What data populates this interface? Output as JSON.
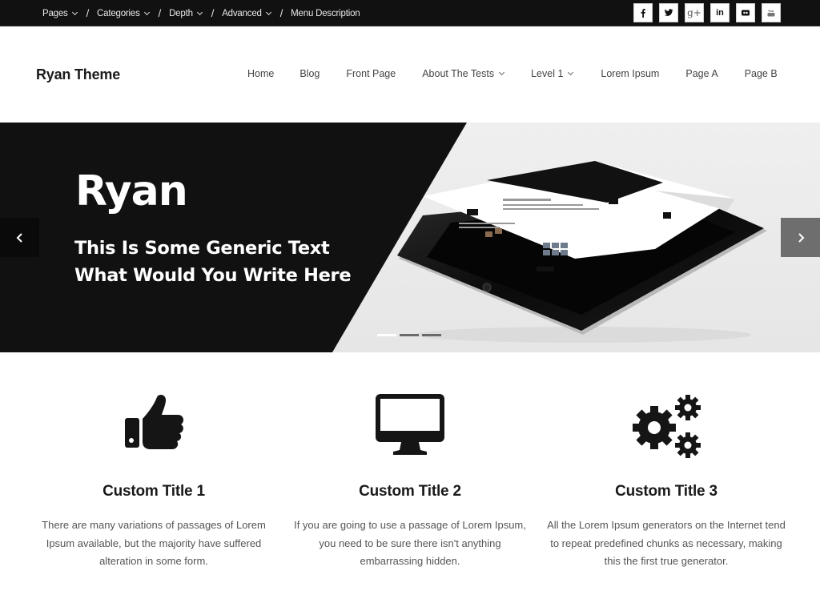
{
  "topbar": {
    "menu": [
      {
        "label": "Pages",
        "has_dropdown": true
      },
      {
        "label": "Categories",
        "has_dropdown": true
      },
      {
        "label": "Depth",
        "has_dropdown": true
      },
      {
        "label": "Advanced",
        "has_dropdown": true
      },
      {
        "label": "Menu Description",
        "has_dropdown": false
      }
    ],
    "separator": "/",
    "social": [
      {
        "name": "facebook",
        "icon": "facebook-icon"
      },
      {
        "name": "twitter",
        "icon": "twitter-icon"
      },
      {
        "name": "google-plus",
        "icon": "google-plus-icon"
      },
      {
        "name": "linkedin",
        "icon": "linkedin-icon"
      },
      {
        "name": "flickr",
        "icon": "flickr-icon"
      },
      {
        "name": "youtube",
        "icon": "youtube-icon"
      }
    ]
  },
  "header": {
    "brand": "Ryan Theme",
    "nav": [
      {
        "label": "Home",
        "has_dropdown": false
      },
      {
        "label": "Blog",
        "has_dropdown": false
      },
      {
        "label": "Front Page",
        "has_dropdown": false
      },
      {
        "label": "About The Tests",
        "has_dropdown": true
      },
      {
        "label": "Level 1",
        "has_dropdown": true
      },
      {
        "label": "Lorem Ipsum",
        "has_dropdown": false
      },
      {
        "label": "Page A",
        "has_dropdown": false
      },
      {
        "label": "Page B",
        "has_dropdown": false
      }
    ]
  },
  "slider": {
    "title": "Ryan",
    "subtitle_line1": "This Is Some Generic Text",
    "subtitle_line2": "What Would You Write Here",
    "slide_count": 3,
    "active_slide": 1,
    "prev_icon": "chevron-left-icon",
    "next_icon": "chevron-right-icon"
  },
  "features": [
    {
      "icon": "thumbs-up-icon",
      "title": "Custom Title 1",
      "text": "There are many variations of passages of Lorem Ipsum available, but the majority have suffered alteration in some form."
    },
    {
      "icon": "monitor-icon",
      "title": "Custom Title 2",
      "text": "If you are going to use a passage of Lorem Ipsum, you need to be sure there isn't anything embarrassing hidden."
    },
    {
      "icon": "gears-icon",
      "title": "Custom Title 3",
      "text": "All the Lorem Ipsum generators on the Internet tend to repeat predefined chunks as necessary, making this the first true generator."
    }
  ],
  "colors": {
    "topbar_bg": "#111111",
    "hero_dark": "#111111",
    "hero_light": "#ececec",
    "next_arrow_bg": "#6e6e6e",
    "text_dark": "#1a1a1a",
    "text_body": "#555555"
  }
}
